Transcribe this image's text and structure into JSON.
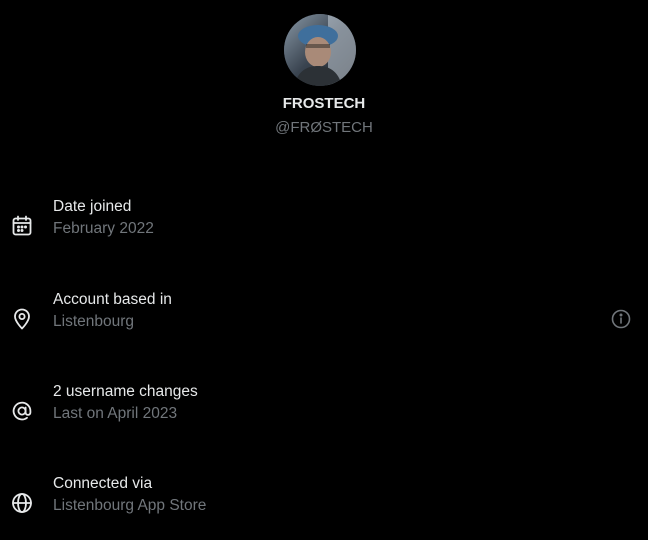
{
  "profile": {
    "avatar_icon": "avatar-photo",
    "display_name": "FROSTECH",
    "handle": "@FRØSTECH"
  },
  "details": [
    {
      "icon": "calendar-icon",
      "label": "Date joined",
      "value": "February 2022"
    },
    {
      "icon": "location-pin-icon",
      "label": "Account based in",
      "value": "Listenbourg",
      "action_icon": "info-icon"
    },
    {
      "icon": "at-sign-icon",
      "label": "2 username changes",
      "value": "Last on April 2023"
    },
    {
      "icon": "globe-icon",
      "label": "Connected via",
      "value": "Listenbourg App Store"
    }
  ],
  "colors": {
    "background": "#000000",
    "primary_text": "#e7e9ea",
    "secondary_text": "#71767b"
  }
}
